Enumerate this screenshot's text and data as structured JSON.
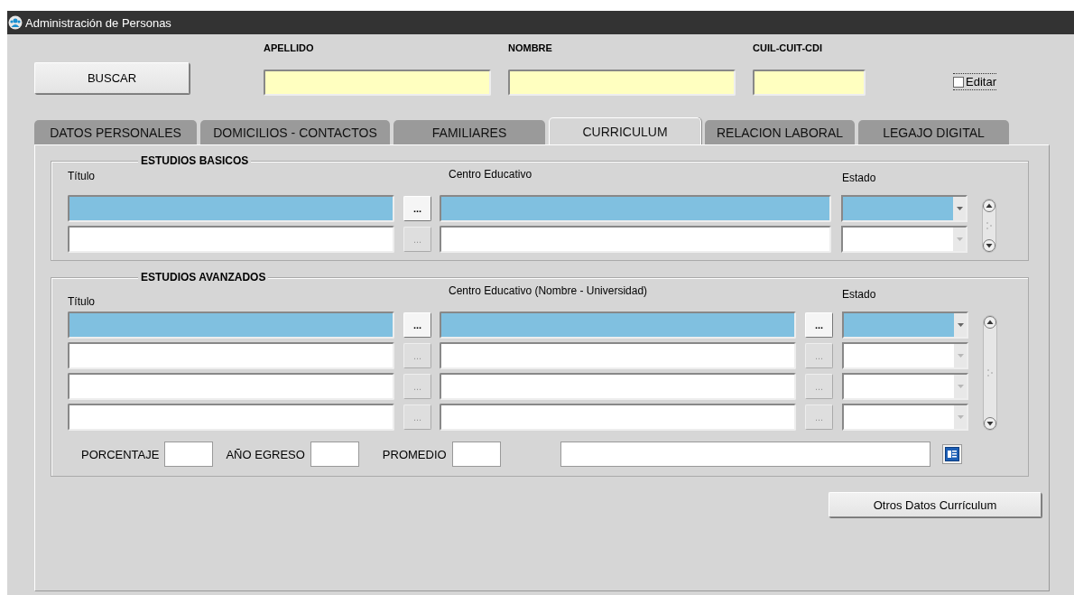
{
  "window": {
    "title": "Administración de Personas"
  },
  "search": {
    "button": "BUSCAR",
    "fields": [
      {
        "label": "APELLIDO"
      },
      {
        "label": "NOMBRE"
      },
      {
        "label": "CUIL-CUIT-CDI"
      }
    ],
    "edit_checkbox": {
      "label": "Editar",
      "checked": false
    }
  },
  "tabs": [
    {
      "label": "DATOS PERSONALES",
      "selected": false
    },
    {
      "label": "DOMICILIOS - CONTACTOS",
      "selected": false
    },
    {
      "label": "FAMILIARES",
      "selected": false
    },
    {
      "label": "CURRICULUM",
      "selected": true
    },
    {
      "label": "RELACION LABORAL",
      "selected": false
    },
    {
      "label": "LEGAJO DIGITAL",
      "selected": false
    }
  ],
  "sections": [
    {
      "title": "ESTUDIOS BASICOS",
      "columns": [
        "Título",
        "Centro Educativo",
        "Estado"
      ],
      "rows": [
        {
          "selected": true,
          "browse_buttons": [
            {
              "label": "...",
              "disabled": false
            }
          ]
        },
        {
          "selected": false,
          "browse_buttons": [
            {
              "label": "...",
              "disabled": true
            }
          ]
        }
      ]
    },
    {
      "title": "ESTUDIOS AVANZADOS",
      "columns": [
        "Título",
        "Centro Educativo (Nombre - Universidad)",
        "Estado"
      ],
      "rows": [
        {
          "selected": true,
          "browse_buttons": [
            {
              "label": "...",
              "disabled": false
            },
            {
              "label": "...",
              "disabled": false
            }
          ]
        },
        {
          "selected": false,
          "browse_buttons": [
            {
              "label": "...",
              "disabled": true
            },
            {
              "label": "...",
              "disabled": true
            }
          ]
        },
        {
          "selected": false,
          "browse_buttons": [
            {
              "label": "...",
              "disabled": true
            },
            {
              "label": "...",
              "disabled": true
            }
          ]
        },
        {
          "selected": false,
          "browse_buttons": [
            {
              "label": "...",
              "disabled": true
            },
            {
              "label": "...",
              "disabled": true
            }
          ]
        }
      ],
      "footer_fields": [
        {
          "label": "PORCENTAJE"
        },
        {
          "label": "AÑO EGRESO"
        },
        {
          "label": "PROMEDIO"
        }
      ]
    }
  ],
  "other_button": "Otros Datos Currículum"
}
